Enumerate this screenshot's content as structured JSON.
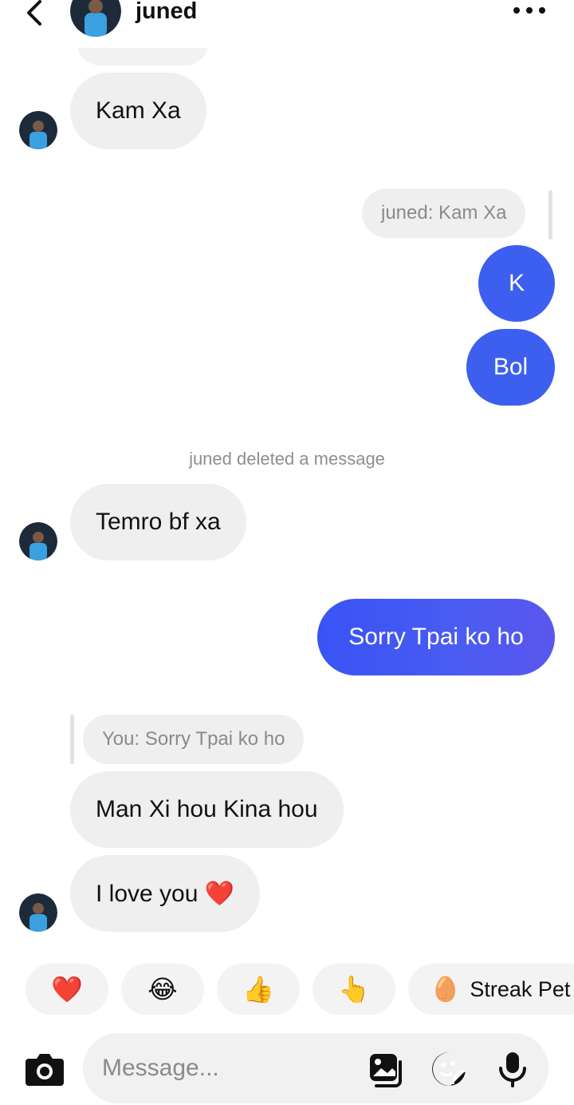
{
  "header": {
    "contact_name": "juned"
  },
  "messages": {
    "m1": "Kam Xa",
    "reply_quote_1": "juned: Kam Xa",
    "m2": "K",
    "m3": "Bol",
    "system_note": "juned deleted a message",
    "m4": "Temro bf xa",
    "m5": "Sorry Tpai ko ho",
    "reply_quote_2": "You: Sorry Tpai ko ho",
    "m6": "Man Xi hou Kina hou",
    "m7": "I love you ❤️"
  },
  "quick_reactions": {
    "r1": "❤️",
    "r2": "😂",
    "r3": "👍",
    "r4": "👆",
    "r5_emoji": "🥚",
    "r5_label": "Streak Pet"
  },
  "composer": {
    "placeholder": "Message..."
  },
  "colors": {
    "outgoing_bubble": "#3d5ff0",
    "incoming_bubble": "#efefef",
    "text_muted": "#8e8e8e"
  },
  "icons": {
    "back": "chevron-left-icon",
    "more": "more-horizontal-icon",
    "camera": "camera-icon",
    "gallery": "gallery-icon",
    "sticker": "sticker-icon",
    "mic": "microphone-icon"
  }
}
